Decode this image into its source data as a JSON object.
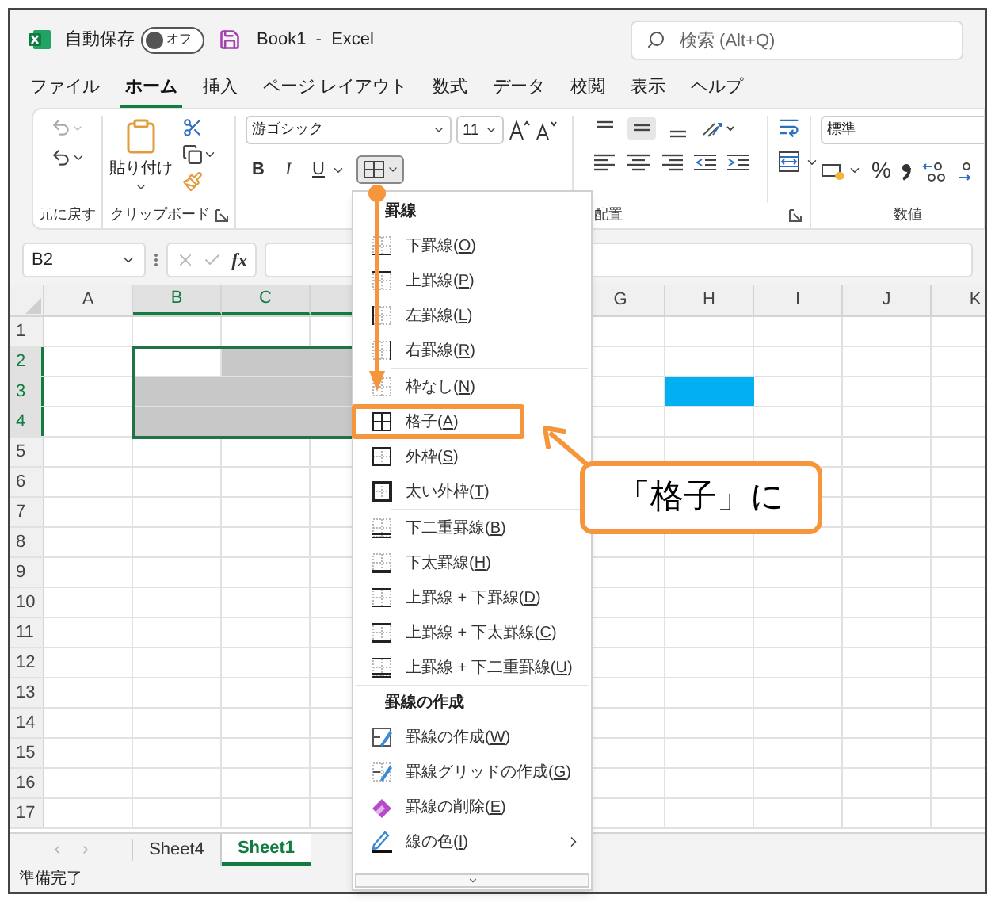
{
  "title_bar": {
    "autosave_label": "自動保存",
    "autosave_toggle": {
      "label": "オフ",
      "on": false
    },
    "title": "Book1  -  Excel",
    "search": {
      "placeholder": "検索 (Alt+Q)"
    }
  },
  "ribbon_tabs": [
    {
      "label": "ファイル",
      "selected": false
    },
    {
      "label": "ホーム",
      "selected": true
    },
    {
      "label": "挿入",
      "selected": false
    },
    {
      "label": "ページ レイアウト",
      "selected": false
    },
    {
      "label": "数式",
      "selected": false
    },
    {
      "label": "データ",
      "selected": false
    },
    {
      "label": "校閲",
      "selected": false
    },
    {
      "label": "表示",
      "selected": false
    },
    {
      "label": "ヘルプ",
      "selected": false
    }
  ],
  "ribbon": {
    "undo_group": {
      "label": "元に戻す"
    },
    "clipboard_group": {
      "paste_label": "貼り付け",
      "label": "クリップボード"
    },
    "font_group": {
      "font_name": "游ゴシック",
      "font_size": "11",
      "style_buttons": [
        "B",
        "I",
        "U"
      ]
    },
    "alignment_group": {
      "label": "配置"
    },
    "number_group": {
      "format": "標準",
      "percent": "%",
      "label": "数値"
    }
  },
  "formula_bar": {
    "name_box": "B2",
    "fx": "fx"
  },
  "grid": {
    "columns_left": [
      {
        "label": "A",
        "selected": false
      },
      {
        "label": "B",
        "selected": true
      },
      {
        "label": "C",
        "selected": true
      },
      {
        "selected": true
      }
    ],
    "columns_right": [
      {
        "label": "G",
        "selected": false
      },
      {
        "label": "H",
        "selected": false
      },
      {
        "label": "I",
        "selected": false
      },
      {
        "label": "J",
        "selected": false
      },
      {
        "label": "K",
        "selected": false
      }
    ],
    "rows": [
      {
        "label": "1",
        "selected": false
      },
      {
        "label": "2",
        "selected": true,
        "cells_left": [
          {
            "kind": "blank"
          },
          {
            "kind": "blank"
          },
          {
            "kind": "filled",
            "color": "#c8c8c8"
          },
          {
            "kind": "filled",
            "color": "#c8c8c8"
          }
        ]
      },
      {
        "label": "3",
        "selected": true,
        "cells_left": [
          {
            "kind": "blank"
          },
          {
            "kind": "filled",
            "color": "#c8c8c8"
          },
          {
            "kind": "filled",
            "color": "#c8c8c8"
          },
          {
            "kind": "filled",
            "color": "#c8c8c8"
          }
        ],
        "cells_right": [
          {
            "kind": "blank"
          },
          {
            "kind": "filled",
            "color": "#00b0f0"
          }
        ]
      },
      {
        "label": "4",
        "selected": true,
        "cells_left": [
          {
            "kind": "blank"
          },
          {
            "kind": "filled",
            "color": "#c8c8c8"
          },
          {
            "kind": "filled",
            "color": "#c8c8c8"
          },
          {
            "kind": "filled",
            "color": "#c8c8c8"
          }
        ]
      },
      {
        "label": "5",
        "selected": false
      },
      {
        "label": "6",
        "selected": false
      },
      {
        "label": "7",
        "selected": false
      },
      {
        "label": "8",
        "selected": false
      },
      {
        "label": "9",
        "selected": false
      },
      {
        "label": "10",
        "selected": false
      },
      {
        "label": "11",
        "selected": false
      },
      {
        "label": "12",
        "selected": false
      },
      {
        "label": "13",
        "selected": false
      },
      {
        "label": "14",
        "selected": false
      },
      {
        "label": "15",
        "selected": false
      },
      {
        "label": "16",
        "selected": false
      },
      {
        "label": "17",
        "selected": false
      }
    ]
  },
  "sheet_tabs": [
    {
      "label": "Sheet4",
      "selected": false
    },
    {
      "label": "Sheet1",
      "selected": true
    }
  ],
  "status_bar": {
    "text": "準備完了"
  },
  "border_menu": {
    "sections": [
      {
        "header": "罫線",
        "groups": [
          [
            {
              "label": "下罫線(",
              "access_key": "O",
              "label_end": ")",
              "kind": "bottom",
              "boxed": false
            },
            {
              "label": "上罫線(",
              "access_key": "P",
              "label_end": ")",
              "kind": "top",
              "boxed": false
            },
            {
              "label": "左罫線(",
              "access_key": "L",
              "label_end": ")",
              "kind": "left",
              "boxed": false
            },
            {
              "label": "右罫線(",
              "access_key": "R",
              "label_end": ")",
              "kind": "right",
              "boxed": false
            }
          ],
          [
            {
              "label": "枠なし(",
              "access_key": "N",
              "label_end": ")",
              "kind": "none",
              "boxed": false
            },
            {
              "label": "格子(",
              "access_key": "A",
              "label_end": ")",
              "kind": "all",
              "boxed": true
            },
            {
              "label": "外枠(",
              "access_key": "S",
              "label_end": ")",
              "kind": "outside",
              "boxed": false
            },
            {
              "label": "太い外枠(",
              "access_key": "T",
              "label_end": ")",
              "kind": "thick",
              "boxed": false
            }
          ],
          [
            {
              "label": "下二重罫線(",
              "access_key": "B",
              "label_end": ")",
              "kind": "double",
              "boxed": false
            },
            {
              "label": "下太罫線(",
              "access_key": "H",
              "label_end": ")",
              "kind": "heavy",
              "boxed": false
            },
            {
              "label": "上罫線 + 下罫線(",
              "access_key": "D",
              "label_end": ")",
              "kind": "topbottom",
              "boxed": false
            },
            {
              "label": "上罫線 + 下太罫線(",
              "access_key": "C",
              "label_end": ")",
              "kind": "topheavy",
              "boxed": false
            },
            {
              "label": "上罫線 + 下二重罫線(",
              "access_key": "U",
              "label_end": ")",
              "kind": "topdouble",
              "boxed": false
            }
          ]
        ]
      },
      {
        "header": "罫線の作成",
        "groups": [
          [
            {
              "label": "罫線の作成(",
              "access_key": "W",
              "label_end": ")",
              "kind": "draw",
              "boxed": false
            },
            {
              "label": "罫線グリッドの作成(",
              "access_key": "G",
              "label_end": ")",
              "kind": "grid",
              "boxed": false
            },
            {
              "label": "罫線の削除(",
              "access_key": "E",
              "label_end": ")",
              "kind": "erase",
              "boxed": false
            },
            {
              "label": "線の色(",
              "access_key": "I",
              "label_end": ")",
              "kind": "color",
              "boxed": false
            }
          ]
        ]
      }
    ]
  },
  "callout": {
    "text": "「格子」に"
  }
}
